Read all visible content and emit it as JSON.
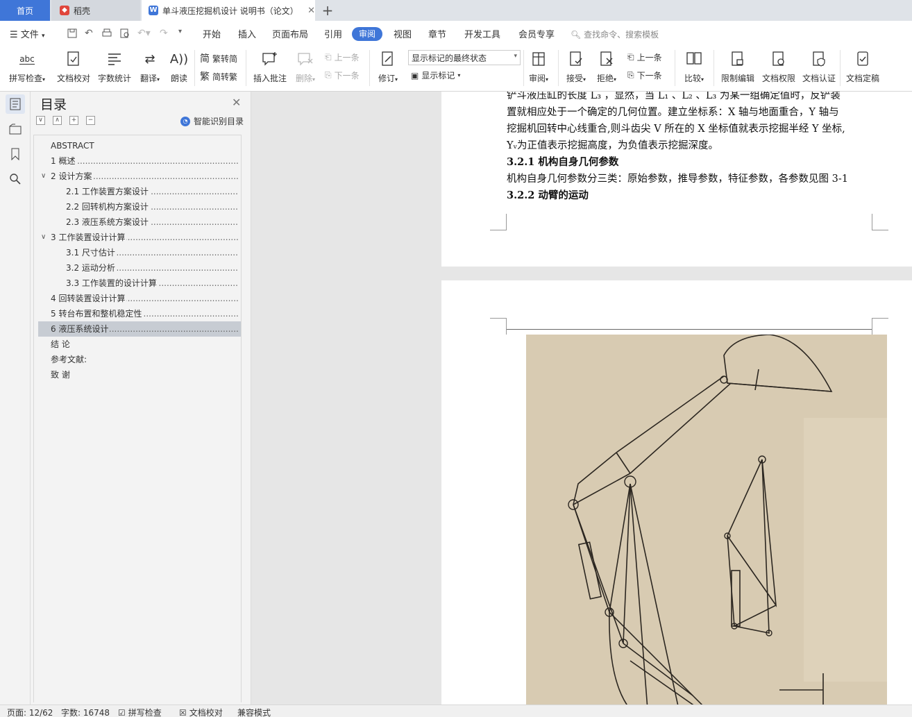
{
  "tabs": {
    "home": "首页",
    "daoke": "稻壳",
    "doc_title": "单斗液压挖掘机设计 说明书（论文）",
    "doc_icon_letter": "W"
  },
  "menubar": {
    "file": "文件",
    "items": [
      "开始",
      "插入",
      "页面布局",
      "引用",
      "审阅",
      "视图",
      "章节",
      "开发工具",
      "会员专享"
    ],
    "active": "审阅",
    "search_placeholder": "查找命令、搜索模板"
  },
  "ribbon": {
    "spell_check": "拼写检查",
    "spell_icon_text": "abc",
    "doc_proof": "文档校对",
    "word_count": "字数统计",
    "translate": "翻译",
    "read_aloud": "朗读",
    "trad_to_simp": "繁转简",
    "simp_to_trad": "简转繁",
    "trad_glyph": "简",
    "simp_glyph": "繁",
    "insert_comment": "插入批注",
    "delete": "删除",
    "prev": "上一条",
    "next": "下一条",
    "track_changes": "修订",
    "markup_state": "显示标记的最终状态",
    "show_markup": "显示标记",
    "review": "审阅",
    "accept": "接受",
    "reject": "拒绝",
    "prev2": "上一条",
    "next2": "下一条",
    "compare": "比较",
    "restrict_edit": "限制编辑",
    "doc_permission": "文档权限",
    "doc_auth": "文档认证",
    "doc_finalize": "文档定稿"
  },
  "toc": {
    "title": "目录",
    "smart": "智能识别目录",
    "items": [
      {
        "text": "ABSTRACT",
        "level": 0,
        "arrow": "",
        "dots": false
      },
      {
        "text": "1  概述",
        "level": 0,
        "arrow": "",
        "dots": true
      },
      {
        "text": "2  设计方案",
        "level": 0,
        "arrow": "∨",
        "dots": true
      },
      {
        "text": "2.1  工作装置方案设计",
        "level": 1,
        "arrow": "",
        "dots": true
      },
      {
        "text": "2.2  回转机构方案设计",
        "level": 1,
        "arrow": "",
        "dots": true
      },
      {
        "text": "2.3  液压系统方案设计",
        "level": 1,
        "arrow": "",
        "dots": true
      },
      {
        "text": "3  工作装置设计计算",
        "level": 0,
        "arrow": "∨",
        "dots": true
      },
      {
        "text": "3.1  尺寸估计",
        "level": 1,
        "arrow": "",
        "dots": true
      },
      {
        "text": "3.2  运动分析",
        "level": 1,
        "arrow": "",
        "dots": true
      },
      {
        "text": "3.3  工作装置的设计计算",
        "level": 1,
        "arrow": "",
        "dots": true
      },
      {
        "text": "4  回转装置设计计算",
        "level": 0,
        "arrow": "",
        "dots": true
      },
      {
        "text": "5  转台布置和整机稳定性",
        "level": 0,
        "arrow": "",
        "dots": true
      },
      {
        "text": "6  液压系统设计",
        "level": 0,
        "arrow": "",
        "dots": true,
        "selected": true
      },
      {
        "text": "结      论",
        "level": 0,
        "arrow": "",
        "dots": false
      },
      {
        "text": "参考文献:",
        "level": 0,
        "arrow": "",
        "dots": false
      },
      {
        "text": "  致    谢",
        "level": 0,
        "arrow": "",
        "dots": false
      }
    ]
  },
  "document": {
    "lines": [
      "铲斗液压缸的长度 L₃ ，显然，当 L₁ 、L₂ 、L₃ 为某一组确定值时，反铲装",
      "置就相应处于一个确定的几何位置。建立坐标系：X 轴与地面重合，Y 轴与",
      "挖掘机回转中心线重合,则斗齿尖 V 所在的 X 坐标值就表示挖掘半经 Y 坐标,",
      "Yᵥ为正值表示挖掘高度，为负值表示挖掘深度。"
    ],
    "h1": "3.2.1 机构自身几何参数",
    "para": "机构自身几何参数分三类：原始参数，推导参数，特征参数，各参数见图 3-1",
    "h2": "3.2.2 动臂的运动"
  },
  "status": {
    "page": "页面: 12/62",
    "words": "字数: 16748",
    "spell": "拼写检查",
    "proof": "文档校对",
    "compat": "兼容模式"
  },
  "colors": {
    "accent": "#3f76d8",
    "figure_bg": "#d8cbb2"
  }
}
